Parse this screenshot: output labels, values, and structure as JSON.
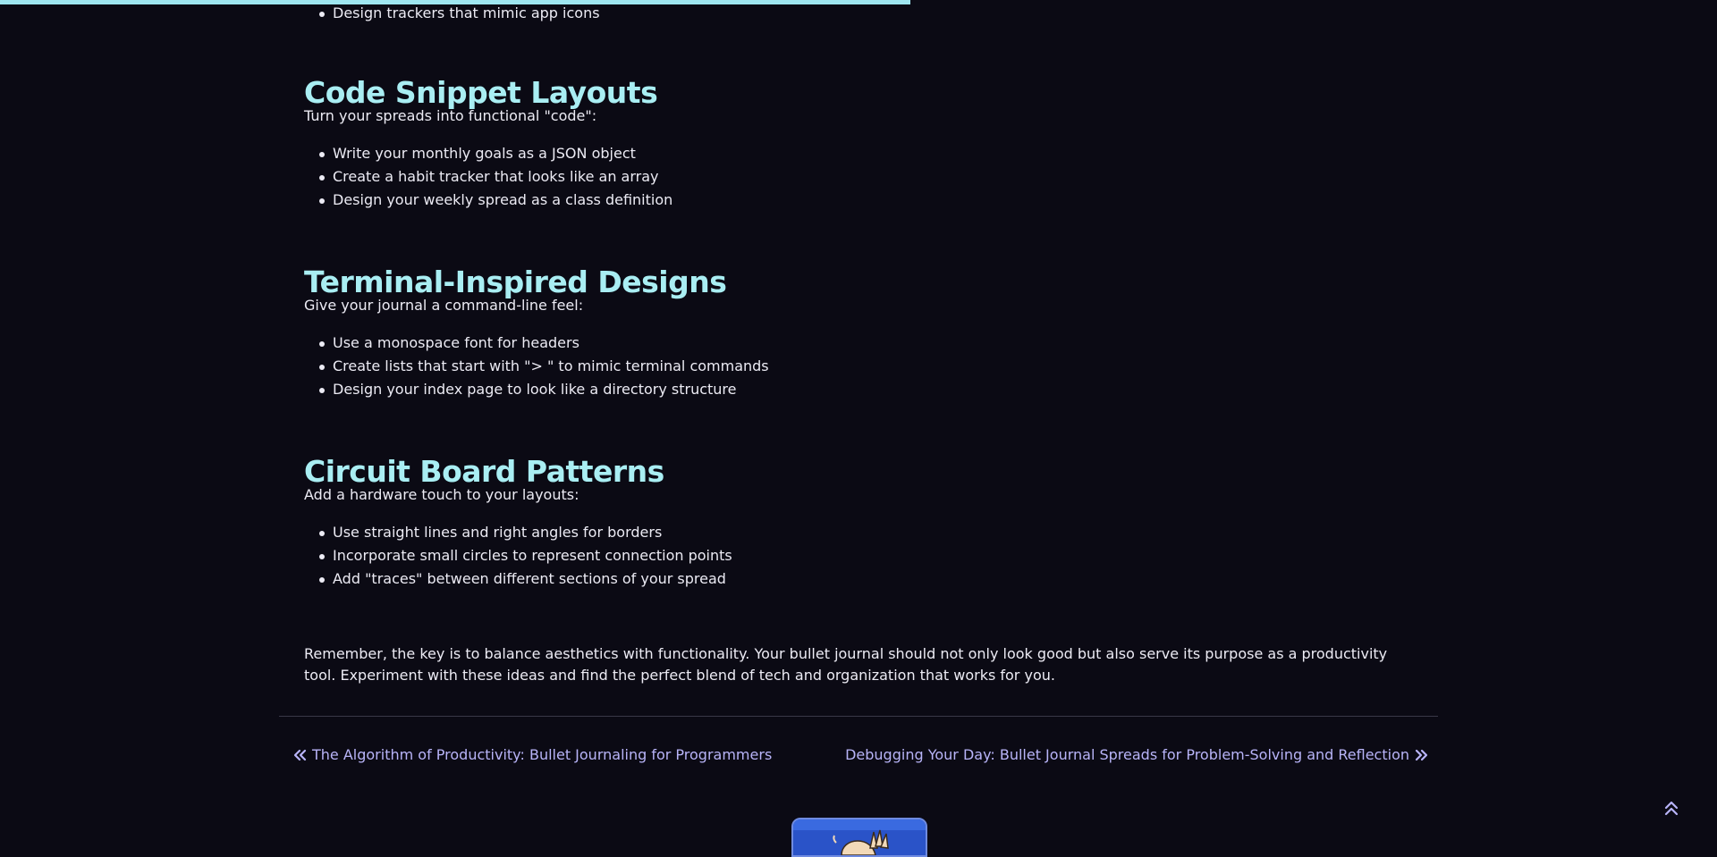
{
  "reading_progress": 0.53,
  "top_item": "Design trackers that mimic app icons",
  "sections": [
    {
      "title": "Code Snippet Layouts",
      "intro": "Turn your spreads into functional \"code\":",
      "items": [
        "Write your monthly goals as a JSON object",
        "Create a habit tracker that looks like an array",
        "Design your weekly spread as a class definition"
      ]
    },
    {
      "title": "Terminal-Inspired Designs",
      "intro": "Give your journal a command-line feel:",
      "items": [
        "Use a monospace font for headers",
        "Create lists that start with \"> \" to mimic terminal commands",
        "Design your index page to look like a directory structure"
      ]
    },
    {
      "title": "Circuit Board Patterns",
      "intro": "Add a hardware touch to your layouts:",
      "items": [
        "Use straight lines and right angles for borders",
        "Incorporate small circles to represent connection points",
        "Add \"traces\" between different sections of your spread"
      ]
    }
  ],
  "outro": "Remember, the key is to balance aesthetics with functionality. Your bullet journal should not only look good but also serve its purpose as a productivity tool. Experiment with these ideas and find the perfect blend of tech and organization that works for you.",
  "post_nav": {
    "prev_label": "The Algorithm of Productivity: Bullet Journaling for Programmers",
    "next_label": "Debugging Your Day: Bullet Journal Spreads for Problem-Solving and Reflection"
  },
  "icons": {
    "prev": "double-chevron-left-icon",
    "next": "double-chevron-right-icon",
    "back_to_top": "double-chevron-up-icon"
  },
  "colors": {
    "background": "#0b0a14",
    "heading": "#a9eef3",
    "link": "#b8b4f8",
    "progress": "#9fe6f0"
  }
}
